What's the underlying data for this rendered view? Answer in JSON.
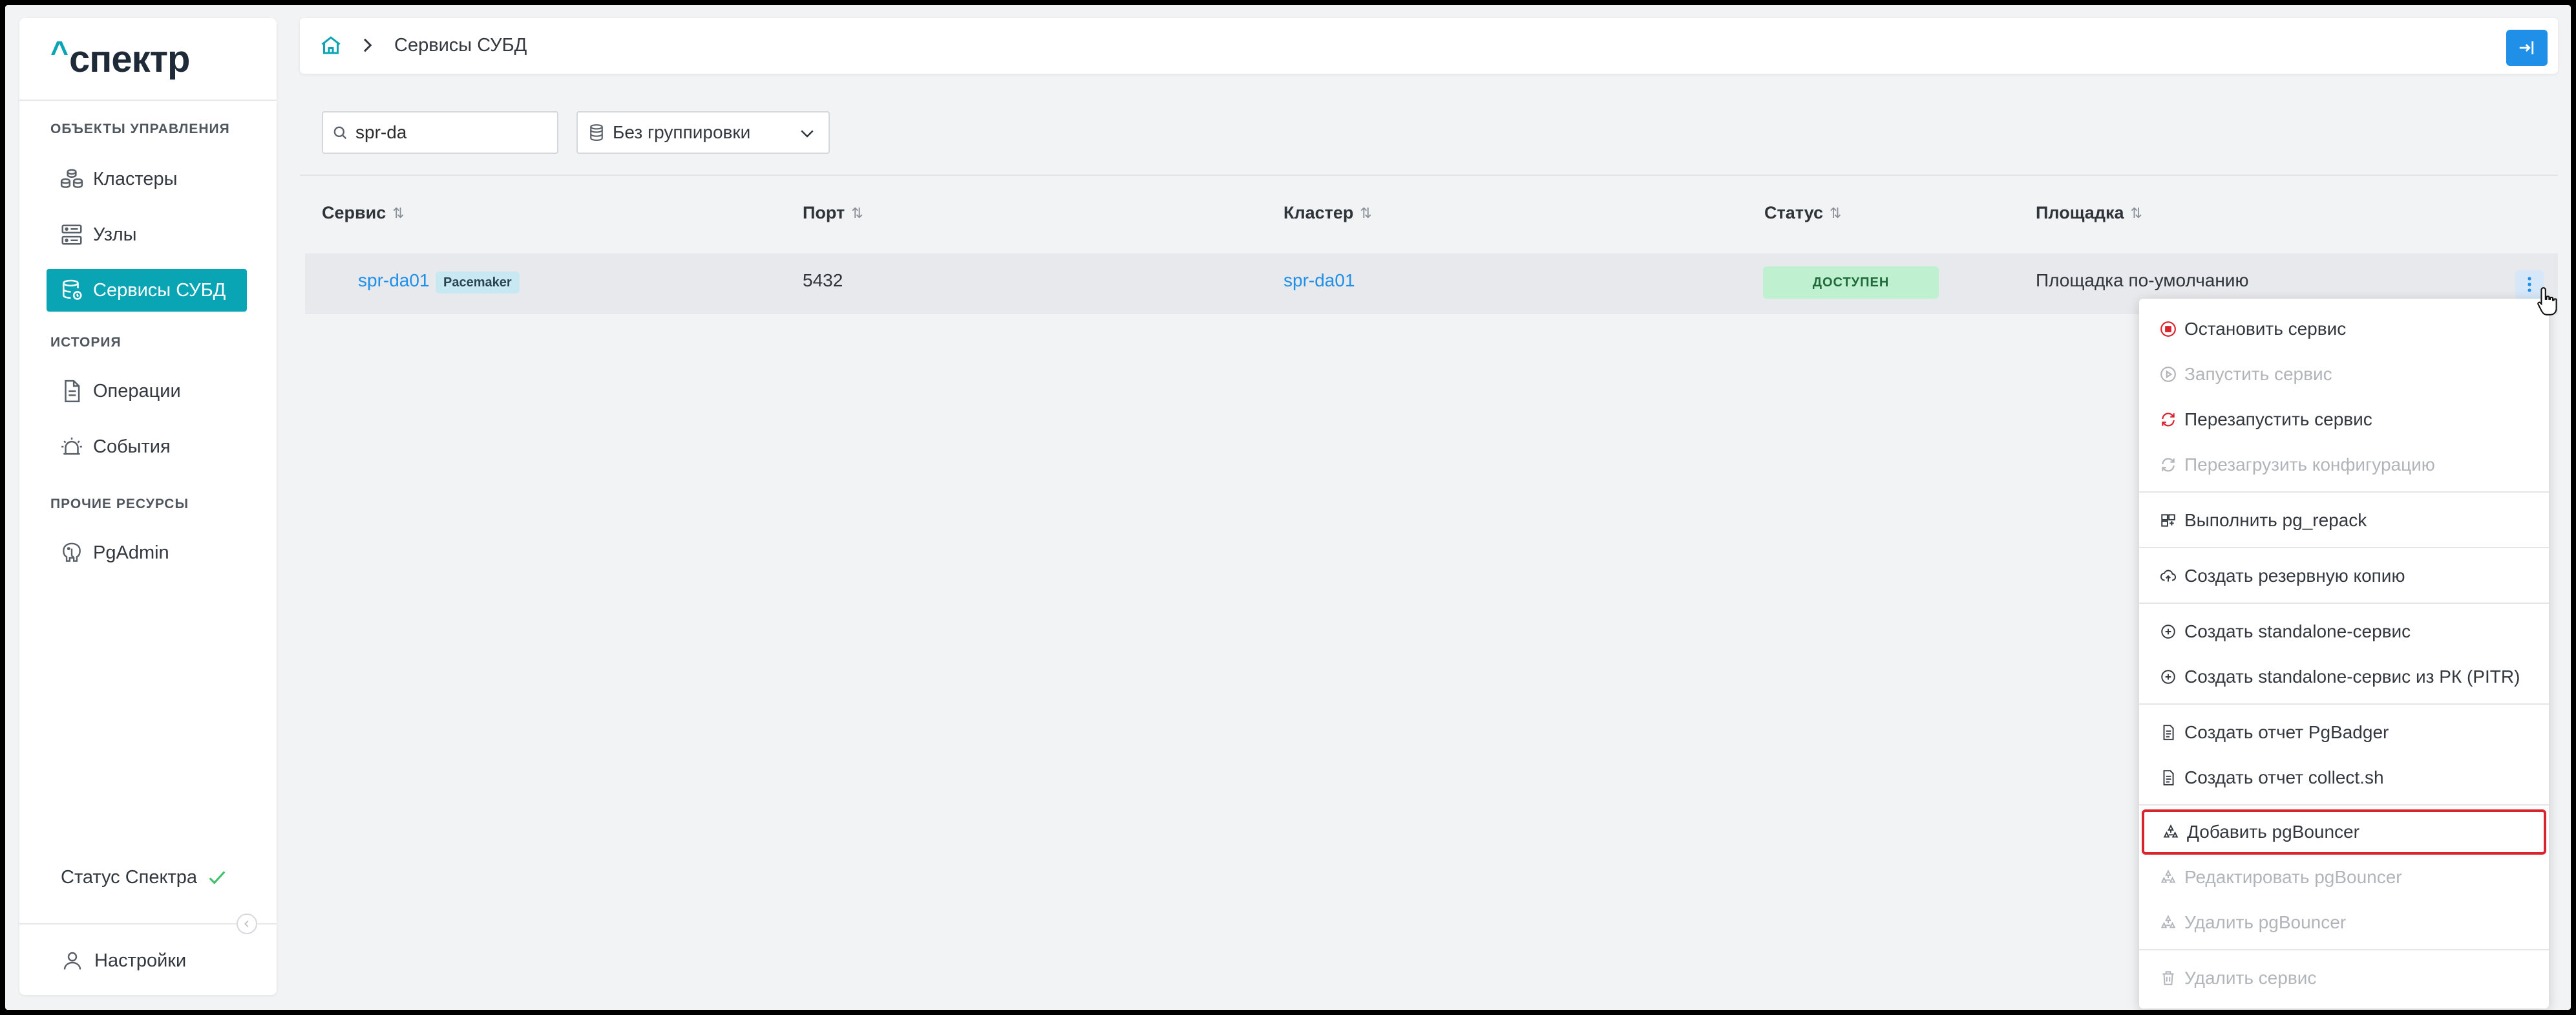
{
  "app": {
    "logo": "спектр"
  },
  "sidebar": {
    "sections": [
      {
        "title": "ОБЪЕКТЫ УПРАВЛЕНИЯ"
      },
      {
        "title": "ИСТОРИЯ"
      },
      {
        "title": "ПРОЧИЕ РЕСУРСЫ"
      }
    ],
    "items": [
      {
        "label": "Кластеры",
        "icon": "cluster-icon"
      },
      {
        "label": "Узлы",
        "icon": "server-icon"
      },
      {
        "label": "Сервисы СУБД",
        "icon": "database-icon",
        "active": true
      },
      {
        "label": "Операции",
        "icon": "document-icon"
      },
      {
        "label": "События",
        "icon": "alarm-icon"
      },
      {
        "label": "PgAdmin",
        "icon": "elephant-icon"
      }
    ],
    "status_label": "Статус Спектра",
    "settings_label": "Настройки"
  },
  "topbar": {
    "breadcrumb": "Сервисы СУБД"
  },
  "filters": {
    "search_value": "spr-da",
    "grouping_label": "Без группировки"
  },
  "table": {
    "columns": [
      "Сервис",
      "Порт",
      "Кластер",
      "Статус",
      "Площадка"
    ],
    "sort_glyph": "⇅",
    "rows": [
      {
        "service": "spr-da01",
        "badge": "Pacemaker",
        "port": "5432",
        "cluster": "spr-da01",
        "status": "ДОСТУПЕН",
        "site": "Площадка по-умолчанию"
      }
    ]
  },
  "menu": {
    "items": [
      {
        "label": "Остановить сервис",
        "icon": "stop-icon",
        "disabled": false
      },
      {
        "label": "Запустить сервис",
        "icon": "play-icon",
        "disabled": true
      },
      {
        "label": "Перезапустить сервис",
        "icon": "restart-icon",
        "disabled": false
      },
      {
        "label": "Перезагрузить конфигурацию",
        "icon": "reload-icon",
        "disabled": true
      },
      {
        "label": "Выполнить pg_repack",
        "icon": "repack-icon",
        "disabled": false
      },
      {
        "label": "Создать резервную копию",
        "icon": "cloud-backup-icon",
        "disabled": false
      },
      {
        "label": "Создать standalone-сервис",
        "icon": "plus-circle-icon",
        "disabled": false
      },
      {
        "label": "Создать standalone-сервис из РК (PITR)",
        "icon": "plus-circle-icon",
        "disabled": false
      },
      {
        "label": "Создать отчет PgBadger",
        "icon": "report-icon",
        "disabled": false
      },
      {
        "label": "Создать отчет collect.sh",
        "icon": "report-icon",
        "disabled": false
      },
      {
        "label": "Добавить pgBouncer",
        "icon": "pgbouncer-icon",
        "disabled": false,
        "highlighted": true
      },
      {
        "label": "Редактировать pgBouncer",
        "icon": "pgbouncer-icon",
        "disabled": true
      },
      {
        "label": "Удалить pgBouncer",
        "icon": "pgbouncer-icon",
        "disabled": true
      },
      {
        "label": "Удалить сервис",
        "icon": "trash-icon",
        "disabled": true
      }
    ]
  },
  "colors": {
    "accent": "#0aa5b4",
    "link": "#1f8fe8",
    "danger": "#d9232d",
    "status_ok_bg": "#bff0cf"
  }
}
